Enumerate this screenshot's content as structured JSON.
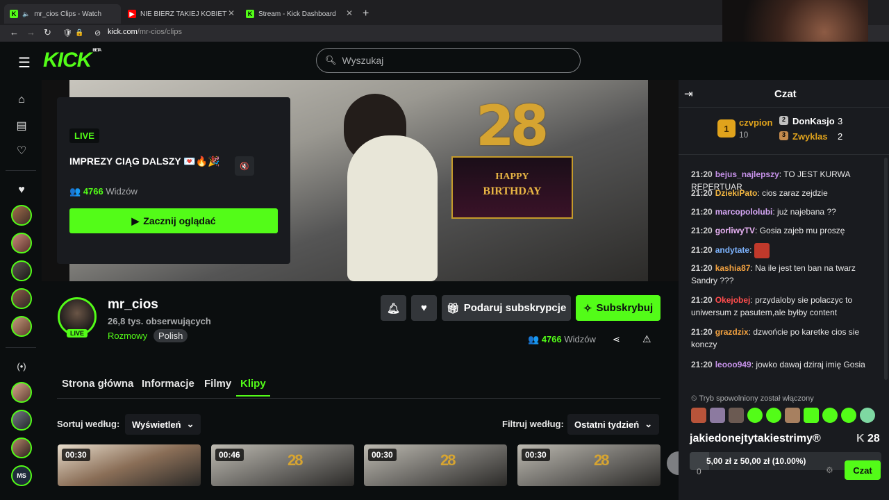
{
  "browser": {
    "tabs": [
      {
        "title": "mr_cios Clips - Watch Live o",
        "icon": "kick-favicon"
      },
      {
        "title": "NIE BIERZ TAKIEJ KOBIETY - You",
        "icon": "youtube-favicon"
      },
      {
        "title": "Stream - Kick Dashboard",
        "icon": "kick-favicon"
      }
    ],
    "url_domain": "kick.com",
    "url_path": "/mr-cios/clips"
  },
  "header": {
    "logo": "KICK",
    "logo_badge": "BETA",
    "search_placeholder": "Wyszukaj"
  },
  "sidebar": {
    "following_avatars": [
      "a1",
      "a2",
      "a3",
      "a4",
      "a5"
    ],
    "recommended_avatars": [
      "r1",
      "r2",
      "r3",
      "MS"
    ]
  },
  "stream_overlay": {
    "live_label": "LIVE",
    "title": "IMPREZY CIĄG DALSZY 💌🔥🎉",
    "viewers": "4766",
    "viewers_label": "Widzów",
    "watch_button": "Zacznij oglądać"
  },
  "video": {
    "balloon": "28",
    "sign_line1": "HAPPY",
    "sign_line2": "BIRTHDAY"
  },
  "channel": {
    "name": "mr_cios",
    "followers": "26,8 tys. obserwujących",
    "category": "Rozmowy",
    "language": "Polish",
    "live_label": "LIVE",
    "gift_button": "Podaruj subskrypcje",
    "subscribe_button": "Subskrybuj",
    "viewers": "4766",
    "viewers_label": "Widzów"
  },
  "tabs": [
    "Strona główna",
    "Informacje",
    "Filmy",
    "Klipy"
  ],
  "active_tab": "Klipy",
  "sort": {
    "label": "Sortuj według:",
    "value": "Wyświetleń"
  },
  "filter": {
    "label": "Filtruj według:",
    "value": "Ostatni tydzień"
  },
  "clips": [
    {
      "duration": "00:30"
    },
    {
      "duration": "00:46"
    },
    {
      "duration": "00:30"
    },
    {
      "duration": "00:30"
    }
  ],
  "chat": {
    "title": "Czat",
    "leaderboard": [
      {
        "rank": "1",
        "name": "czvpion",
        "count": "10"
      },
      {
        "rank": "2",
        "name": "DonKasjo",
        "count": "3"
      },
      {
        "rank": "3",
        "name": "Zwyklas",
        "count": "2"
      }
    ],
    "messages": [
      {
        "time": "21:20",
        "user": "bejus_najlepszy",
        "color": "#c792ea",
        "text": "TO JEST KURWA REPERTUAR"
      },
      {
        "time": "21:20",
        "user": "DziekiPato",
        "color": "#f5b841",
        "text": "cios zaraz zejdzie"
      },
      {
        "time": "21:20",
        "user": "marcopololubi",
        "color": "#d7a8f7",
        "text": "już najebana ??"
      },
      {
        "time": "21:20",
        "user": "gorliwyTV",
        "color": "#e6b0f2",
        "text": "Gosia zajeb mu proszę"
      },
      {
        "time": "21:20",
        "user": "andytate",
        "color": "#7db4ff",
        "text": ""
      },
      {
        "time": "21:20",
        "user": "kashia87",
        "color": "#f5a340",
        "text": "Na ile jest ten ban na twarz Sandry ???"
      },
      {
        "time": "21:20",
        "user": "Okejobej",
        "color": "#ff4d4d",
        "text": "przydaloby sie polaczyc to uniwersum z pasutem,ale byłby content"
      },
      {
        "time": "21:20",
        "user": "grazdzix",
        "color": "#f5a340",
        "text": "dzwońcie po karetke cios sie konczy"
      },
      {
        "time": "21:20",
        "user": "leooo949",
        "color": "#c792ea",
        "text": "jowko dawaj dziraj imię Gosia"
      }
    ],
    "slow_mode": "Tryb spowolniony został włączony",
    "goal_title": "jakiedonejtytakiestrimy®",
    "goal_count": "28",
    "goal_amount": "5,00 zł z 50,00 zł (10.00%)",
    "goal_progress": 0.1,
    "send_button": "Czat",
    "input_value": "0"
  },
  "colors": {
    "accent": "#53fc18",
    "background": "#0b0e0f",
    "panel": "#191b1f"
  }
}
